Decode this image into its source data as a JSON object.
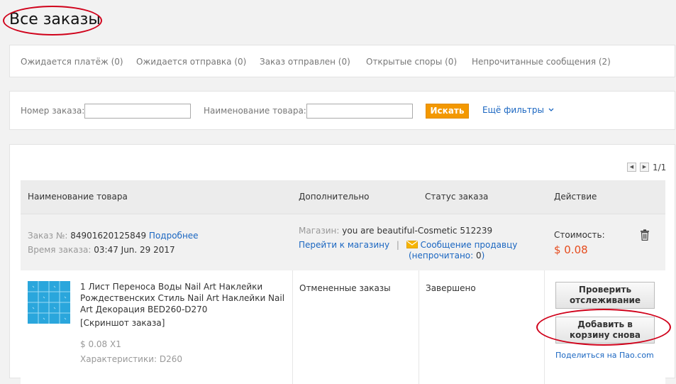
{
  "page": {
    "title": "Все заказы"
  },
  "tabs": [
    "Ожидается платёж (0)",
    "Ожидается отправка (0)",
    "Заказ отправлен (0)",
    "Открытые споры (0)",
    "Непрочитанные сообщения (2)"
  ],
  "filters": {
    "order_number_label": "Номер заказа:",
    "order_number_value": "",
    "product_name_label": "Наименование товара:",
    "product_name_value": "",
    "search_label": "Искать",
    "more_filters_label": "Ещё фильтры"
  },
  "pager": {
    "text": "1/1",
    "prev": "◀",
    "next": "▶"
  },
  "table": {
    "headers": [
      "Наименование товара",
      "Дополнительно",
      "Статус заказа",
      "Действие"
    ]
  },
  "order": {
    "number_label": "Заказ №:",
    "number": "84901620125849",
    "details_link": "Подробнее",
    "time_label": "Время заказа:",
    "time": "03:47 Jun. 29 2017",
    "store_label": "Магазин:",
    "store_name": "you are beautiful-Cosmetic 512239",
    "go_to_store": "Перейти к магазину",
    "separator": "|",
    "message_seller": "Сообщение продавцу",
    "unread_open": "(непрочитано:",
    "unread_count": "0",
    "unread_close": ")",
    "cost_label": "Стоимость:",
    "price": "$ 0.08"
  },
  "item": {
    "title": "1 Лист Переноса Воды Nail Art Наклейки Рождественских Стиль Nail Art Наклейки Nail Art Декорация BED260-D270",
    "snapshot": "[Скриншот заказа]",
    "price_qty": "$ 0.08 X1",
    "characteristics": "Характеристики: D260",
    "extra_status": "Отмененные заказы",
    "order_status": "Завершено",
    "track_button": "Проверить отслеживание",
    "add_to_cart_button": "Добавить в корзину снова",
    "share_link": "Поделиться на Пао.com"
  },
  "colors": {
    "accent_orange": "#f39800",
    "price_red": "#e64c1e",
    "link_blue": "#1a66c1",
    "annotation_red": "#d0021b"
  }
}
